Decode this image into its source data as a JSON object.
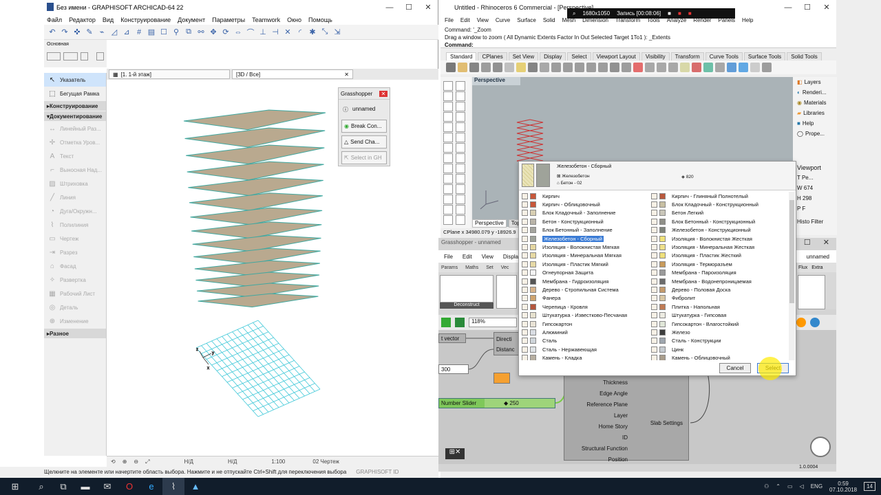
{
  "archicad": {
    "title": "Без имени - GRAPHISOFT ARCHICAD-64 22",
    "menu": [
      "Файл",
      "Редактор",
      "Вид",
      "Конструирование",
      "Документ",
      "Параметры",
      "Teamwork",
      "Окно",
      "Помощь"
    ],
    "toolbox_label": "Основная",
    "left_items": [
      {
        "label": "Указатель",
        "state": "sel"
      },
      {
        "label": "Бегущая Рамка",
        "state": "norm"
      }
    ],
    "heads": {
      "construct": "Конструирование",
      "document": "Документирование",
      "misc": "Разное"
    },
    "doc_items": [
      "Линейный Раз...",
      "Отметка Уров...",
      "Текст",
      "Выносная Над...",
      "Штриховка",
      "Линия",
      "Дуга/Окружн...",
      "Полилиния",
      "Чертеж",
      "Разрез",
      "Фасад",
      "Развертка",
      "Рабочий Лист",
      "Деталь",
      "Изменение"
    ],
    "tabs": [
      "[1. 1-й этаж]",
      "[3D / Все]"
    ],
    "gh_popup": {
      "title": "Grasshopper",
      "unnamed": "unnamed",
      "break": "Break Con...",
      "send": "Send Cha...",
      "select": "Select in GH"
    },
    "bottom": {
      "nd1": "Н/Д",
      "nd2": "Н/Д",
      "scale": "1:100",
      "layer": "02 Чертеж"
    },
    "status": "Щелкните на элементе или начертите область выбора. Нажмите и не отпускайте Ctrl+Shift для переключения выбора",
    "brand": "GRAPHISOFT ID"
  },
  "rhino": {
    "title": "Untitled - Rhinoceros 6 Commercial - [Perspective]",
    "menu": [
      "File",
      "Edit",
      "View",
      "Curve",
      "Surface",
      "Solid",
      "Mesh",
      "Dimension",
      "Transform",
      "Tools",
      "Analyze",
      "Render",
      "Panels",
      "Help"
    ],
    "cmd1": "Command: '_Zoom",
    "cmd2": "Drag a window to zoom ( All  Dynamic  Extents  Factor  In  Out  Selected  Target  1To1 ): _Extents",
    "cmd3": "Command:",
    "tabs": [
      "Standard",
      "CPlanes",
      "Set View",
      "Display",
      "Select",
      "Viewport Layout",
      "Visibility",
      "Transform",
      "Curve Tools",
      "Surface Tools",
      "Solid Tools"
    ],
    "viewport": "Perspective",
    "right": [
      "Layers",
      "Renderi...",
      "Materials",
      "Libraries",
      "Help",
      "Prope..."
    ],
    "viewport_panel": "Viewport",
    "vp_fields": [
      "T Pe...",
      "W 674",
      "H 298",
      "P F"
    ],
    "bottom_tabs": [
      "Perspective",
      "Top"
    ],
    "cplane": "CPlane  x 34980.079  y -18926.9",
    "histo": "Histo  Filter"
  },
  "recorder": {
    "res": "1680x1050",
    "rec": "Запись [00:08:06]"
  },
  "gh": {
    "title": "Grasshopper - unnamed",
    "menu": [
      "File",
      "Edit",
      "View",
      "Display"
    ],
    "tabs": [
      "Params",
      "Maths",
      "Set",
      "Vec"
    ],
    "tabs_right": [
      "Flux",
      "Extra"
    ],
    "unnamed": "unnamed",
    "deconstruct": "Deconstruct",
    "zoom": "118%",
    "nodes": {
      "vector": "t vector",
      "direction": "Directi",
      "distance": "Distanc",
      "n300": "300",
      "slider": "Number Slider",
      "slider_val": "250"
    },
    "params": [
      "Thickness",
      "Edge Angle",
      "Reference Plane",
      "Layer",
      "Home Story",
      "ID",
      "Structural Function",
      "Position"
    ],
    "output": "Slab Settings",
    "version": "1.0.0004"
  },
  "dialog": {
    "selected_name": "Железобетон - Сборный",
    "sub1": "Железобетон",
    "sub2": "Бетон - 02",
    "code": "820",
    "left": [
      [
        "Кирпич",
        "#c8573a"
      ],
      [
        "Кирпич - Облицовочный",
        "#c8573a"
      ],
      [
        "Блок Кладочный - Заполнение",
        "#d8cfb3"
      ],
      [
        "Бетон - Конструкционный",
        "#b9b4a8"
      ],
      [
        "Блок Бетонный - Заполнение",
        "#a5a59e"
      ],
      [
        "Железобетон - Сборный",
        "#9fa39a"
      ],
      [
        "Изоляция - Волокнистая Мягкая",
        "#e5d7a1"
      ],
      [
        "Изоляция - Минеральная Мягкая",
        "#e7d9a3"
      ],
      [
        "Изоляция - Пластик Мягкий",
        "#e6d9a6"
      ],
      [
        "Огнеупорная Защита",
        "#f3f3f3"
      ],
      [
        "Мембрана - Гидроизоляция",
        "#555555"
      ],
      [
        "Дерево - Стропильная Система",
        "#d7b48c"
      ],
      [
        "Фанера",
        "#cfa46f"
      ],
      [
        "Черепица - Кровля",
        "#b5573d"
      ],
      [
        "Штукатурка - Известково-Песчаная",
        "#e7e2cf"
      ],
      [
        "Гипсокартон",
        "#e9e3d6"
      ],
      [
        "Алюминий",
        "#d9dde3"
      ],
      [
        "Сталь",
        "#cfd5da"
      ],
      [
        "Сталь - Нержавеющая",
        "#dfe3e6"
      ],
      [
        "Камень - Кладка",
        "#b7afa1"
      ]
    ],
    "right": [
      [
        "Кирпич - Глиняный Полнотелый",
        "#b9583c"
      ],
      [
        "Блок Кладочный - Конструкционный",
        "#c7bfa2"
      ],
      [
        "Бетон Легкий",
        "#c9c6b9"
      ],
      [
        "Блок Бетонный - Конструкционный",
        "#8f8f88"
      ],
      [
        "Железобетон - Конструкционный",
        "#7f847c"
      ],
      [
        "Изоляция - Волокнистая Жесткая",
        "#f0e27a"
      ],
      [
        "Изоляция - Минеральная Жесткая",
        "#eee08a"
      ],
      [
        "Изоляция - Пластик Жесткий",
        "#eedf7a"
      ],
      [
        "Изоляция - Терморазъем",
        "#c89a5b"
      ],
      [
        "Мембрана - Пароизоляция",
        "#9a9a9a"
      ],
      [
        "Мембрана - Водонепроницаемая",
        "#6b6b6b"
      ],
      [
        "Дерево - Половая Доска",
        "#c49a6c"
      ],
      [
        "Фибролит",
        "#d9c7a4"
      ],
      [
        "Плитка - Напольная",
        "#c07b54"
      ],
      [
        "Штукатурка - Гипсовая",
        "#ecebe2"
      ],
      [
        "Гипсокартон - Влагостойкий",
        "#e0e6d8"
      ],
      [
        "Железо",
        "#3d3d3d"
      ],
      [
        "Сталь - Конструкции",
        "#9ea6ae"
      ],
      [
        "Цинк",
        "#c6cbd0"
      ],
      [
        "Камень - Облицовочный",
        "#a99d8c"
      ]
    ],
    "cancel": "Cancel",
    "select": "Select"
  },
  "taskbar": {
    "lang": "ENG",
    "time": "0:59",
    "date": "07.10.2018",
    "notif": "14"
  }
}
